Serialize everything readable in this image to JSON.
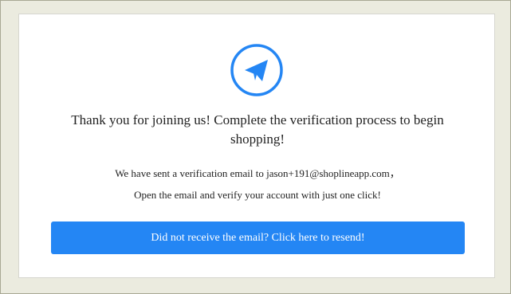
{
  "icon": "paper-plane-icon",
  "accent_color": "#2486f4",
  "headline": "Thank you for joining us! Complete the verification process to begin shopping!",
  "message": {
    "line1": "We have sent a verification email to jason+191@shoplineapp.com，",
    "line2": "Open the email and verify your account with just one click!"
  },
  "resend_button_label": "Did not receive the email? Click here to resend!"
}
